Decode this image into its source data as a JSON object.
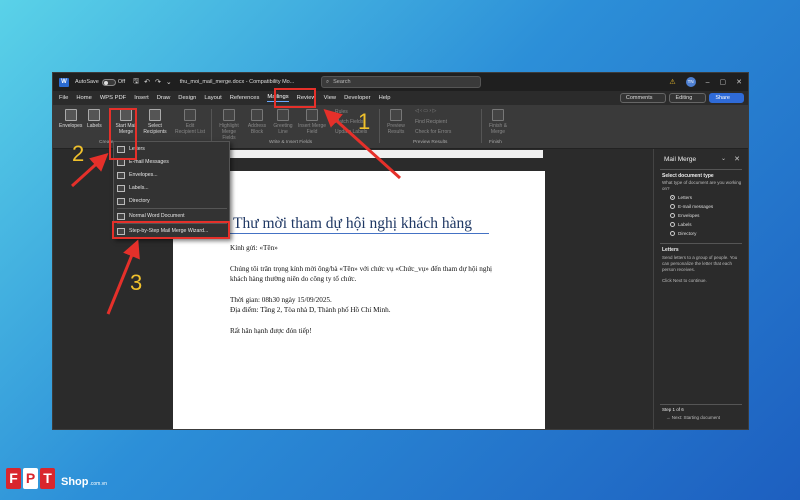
{
  "titlebar": {
    "autosave_label": "AutoSave",
    "autosave_state": "Off",
    "filename": "thu_moi_mail_merge.docx - Compatibility Mo...",
    "search_placeholder": "Search",
    "user_initials": "TN"
  },
  "menubar": {
    "tabs": [
      "File",
      "Home",
      "WPS PDF",
      "Insert",
      "Draw",
      "Design",
      "Layout",
      "References",
      "Mailings",
      "Review",
      "View",
      "Developer",
      "Help"
    ],
    "comments_label": "Comments",
    "editing_label": "Editing",
    "share_label": "Share"
  },
  "ribbon": {
    "envelopes": "Envelopes",
    "labels": "Labels",
    "start_mail_merge": "Start Mail Merge",
    "select_recipients": "Select Recipients",
    "edit_recipient_list": "Edit Recipient List",
    "highlight_merge_fields": "Highlight Merge Fields",
    "address_block": "Address Block",
    "greeting_line": "Greeting Line",
    "insert_merge_field": "Insert Merge Field",
    "rules": "Rules",
    "match_fields": "Match Fields",
    "update_labels": "Update Labels",
    "preview_results": "Preview Results",
    "find_recipient": "Find Recipient",
    "check_for_errors": "Check for Errors",
    "finish_merge": "Finish & Merge",
    "group_create": "Create",
    "group_write_insert": "Write & Insert Fields",
    "group_preview": "Preview Results",
    "group_finish": "Finish"
  },
  "dropdown": {
    "items": [
      "Letters",
      "E-mail Messages",
      "Envelopes...",
      "Labels...",
      "Directory",
      "Normal Word Document",
      "Step-by-Step Mail Merge Wizard..."
    ]
  },
  "document": {
    "title": "Thư mời tham dự hội nghị khách hàng",
    "greeting": "Kính gửi: «Tên»",
    "body": "Chúng tôi trân trọng kính mời ông/bà «Tên» với chức vụ «Chức_vụ» đến tham dự hội nghị khách hàng thường niên do công ty tổ chức.",
    "time": "Thời gian: 08h30 ngày 15/09/2025.",
    "location": "Địa điểm: Tầng 2, Tòa nhà D, Thành phố Hồ Chí Minh.",
    "closing": "Rất hân hạnh được đón tiếp!"
  },
  "pane": {
    "title": "Mail Merge",
    "select_type_heading": "Select document type",
    "select_type_desc": "What type of document are you working on?",
    "options": [
      "Letters",
      "E-mail messages",
      "Envelopes",
      "Labels",
      "Directory"
    ],
    "selected": "Letters",
    "letters_heading": "Letters",
    "letters_desc": "Send letters to a group of people. You can personalize the letter that each person receives.",
    "next_hint": "Click Next to continue.",
    "step": "Step 1 of 6",
    "next_link": "Next: Starting document"
  },
  "annotations": {
    "step1": "1",
    "step2": "2",
    "step3": "3",
    "color": "#e5302a",
    "number_color": "#f0c12c"
  },
  "brand": {
    "letters": [
      "F",
      "P",
      "T"
    ],
    "shop": "Shop",
    "domain": ".com.vn"
  }
}
